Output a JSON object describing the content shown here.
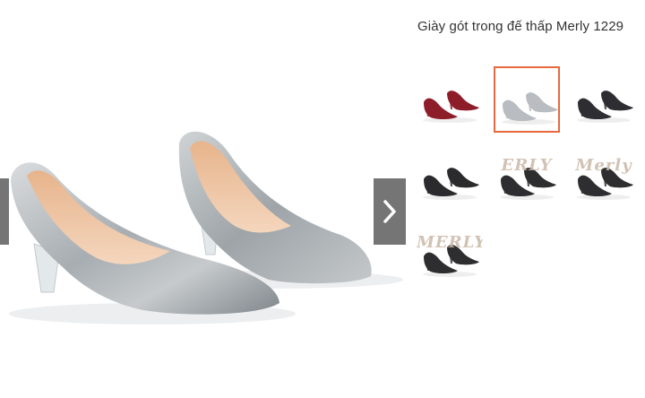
{
  "product": {
    "title": "Giày gót trong đế thấp Merly 1229"
  },
  "gallery": {
    "prev_icon": "chevron-left-icon",
    "next_icon": "chevron-right-icon",
    "selected_index": 1,
    "thumbnails": [
      {
        "name": "thumbnail-red-pumps",
        "color": "#8e1d2a",
        "label": ""
      },
      {
        "name": "thumbnail-silver-pumps",
        "color": "#b9bcc0",
        "label": ""
      },
      {
        "name": "thumbnail-black-pumps",
        "color": "#2e2e32",
        "label": ""
      },
      {
        "name": "thumbnail-black-pumps-side",
        "color": "#2b2b2e",
        "label": ""
      },
      {
        "name": "thumbnail-merly-sign-1",
        "color": "#2e2e30",
        "label": "ERLY"
      },
      {
        "name": "thumbnail-merly-sign-2",
        "color": "#2e2e30",
        "label": "Merly"
      },
      {
        "name": "thumbnail-merly-sign-3",
        "color": "#2e2e30",
        "label": "MERLY"
      }
    ]
  },
  "colors": {
    "accent_border": "#e8683f",
    "nav_button": "#757575",
    "title_text": "#333333"
  }
}
